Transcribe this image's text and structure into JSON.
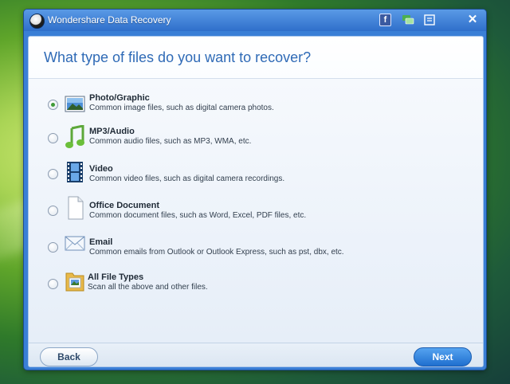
{
  "window": {
    "title": "Wondershare Data Recovery",
    "titlebar_icons": [
      "facebook-icon",
      "chat-icon",
      "feedback-icon",
      "close-icon"
    ]
  },
  "header": {
    "title": "What type of files do you want to recover?"
  },
  "options": [
    {
      "label": "Photo/Graphic",
      "description": "Common image files, such as digital camera photos.",
      "icon": "photo-icon",
      "selected": true
    },
    {
      "label": "MP3/Audio",
      "description": "Common audio files, such as MP3, WMA, etc.",
      "icon": "music-note-icon",
      "selected": false
    },
    {
      "label": "Video",
      "description": "Common video files, such as digital camera recordings.",
      "icon": "film-strip-icon",
      "selected": false
    },
    {
      "label": "Office Document",
      "description": "Common document files, such as Word, Excel, PDF files, etc.",
      "icon": "document-icon",
      "selected": false
    },
    {
      "label": "Email",
      "description": "Common emails from Outlook or Outlook Express, such as pst, dbx, etc.",
      "icon": "envelope-icon",
      "selected": false
    },
    {
      "label": "All File Types",
      "description": "Scan all the above and other files.",
      "icon": "folder-icon",
      "selected": false
    }
  ],
  "footer": {
    "back_label": "Back",
    "next_label": "Next"
  },
  "colors": {
    "accent": "#2f6ab6",
    "titlebar": "#3a7fd6",
    "next_button": "#1f6fcf",
    "radio_selected": "#3f9a38"
  }
}
